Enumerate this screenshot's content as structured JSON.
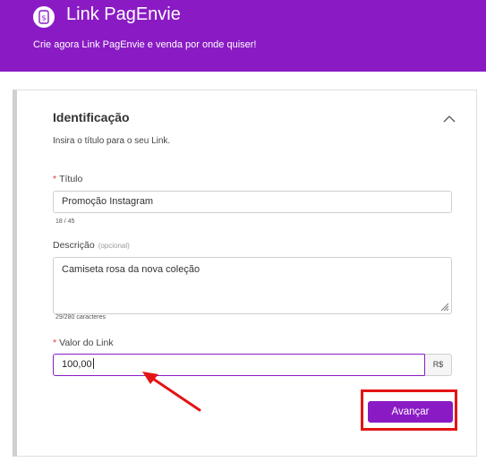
{
  "header": {
    "logo_icon": "dollar-tag-icon",
    "title": "Link PagEnvie",
    "subtitle": "Crie agora Link PagEnvie e venda por onde quiser!"
  },
  "section": {
    "title": "Identificação",
    "description": "Insira o título para o seu Link.",
    "toggle_icon": "chevron-up-icon"
  },
  "form": {
    "title": {
      "required_mark": "*",
      "label": "Título",
      "value": "Promoção Instagram",
      "counter": "18 / 45"
    },
    "description": {
      "label": "Descrição",
      "optional_label": "(opcional)",
      "value": "Camiseta rosa da nova coleção",
      "counter": "29/280 caracteres"
    },
    "amount": {
      "required_mark": "*",
      "label": "Valor do Link",
      "value": "100,00",
      "currency": "R$"
    }
  },
  "actions": {
    "next_label": "Avançar"
  },
  "colors": {
    "brand": "#8a1bc4",
    "highlight": "#e41414"
  }
}
